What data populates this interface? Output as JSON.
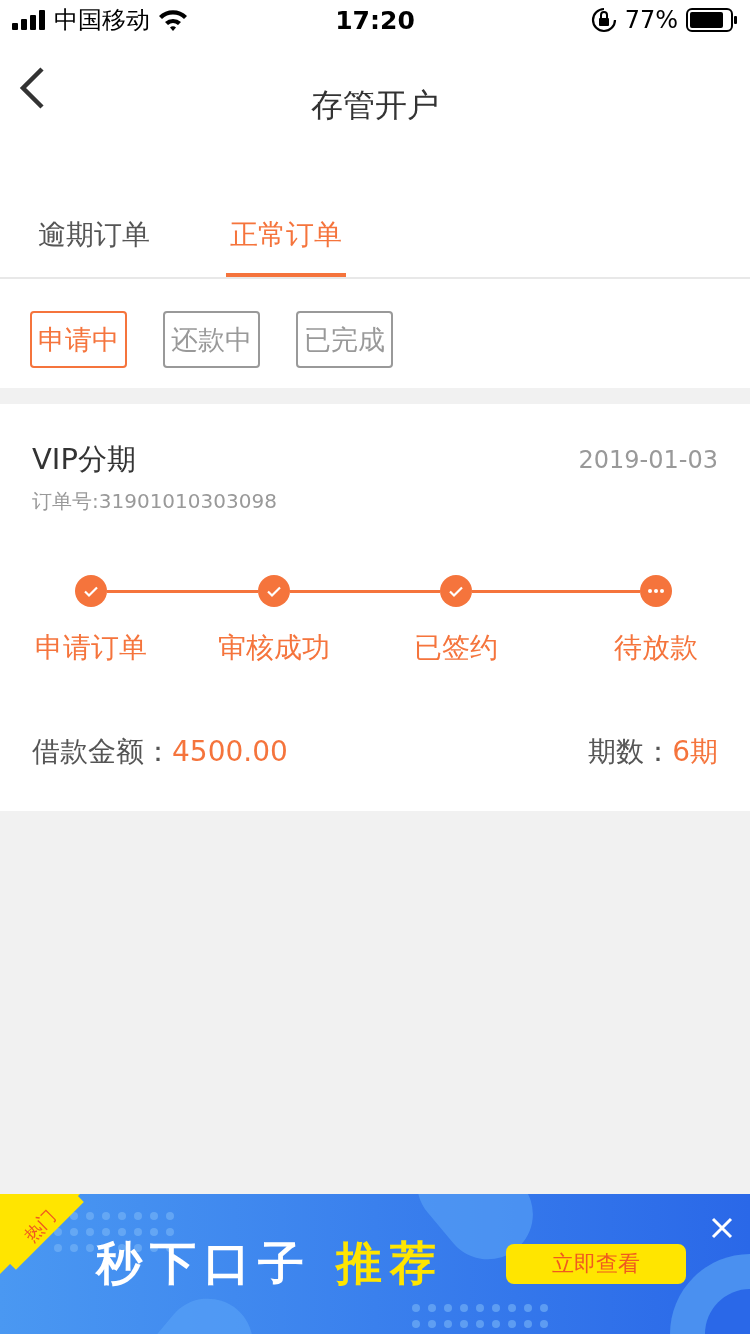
{
  "status_bar": {
    "carrier": "中国移动",
    "time": "17:20",
    "battery": "77%"
  },
  "nav": {
    "title": "存管开户"
  },
  "tabs": [
    {
      "label": "逾期订单",
      "selected": false
    },
    {
      "label": "正常订单",
      "selected": true
    }
  ],
  "filters": [
    {
      "label": "申请中",
      "selected": true
    },
    {
      "label": "还款中",
      "selected": false
    },
    {
      "label": "已完成",
      "selected": false
    }
  ],
  "order": {
    "title": "VIP分期",
    "date": "2019-01-03",
    "order_no": "订单号:31901010303098",
    "steps": [
      {
        "label": "申请订单",
        "kind": "done"
      },
      {
        "label": "审核成功",
        "kind": "done"
      },
      {
        "label": "已签约",
        "kind": "done"
      },
      {
        "label": "待放款",
        "kind": "pending"
      }
    ],
    "amount_label": "借款金额：",
    "amount": "4500.00",
    "periods_label": "期数：",
    "periods": "6期"
  },
  "banner": {
    "tag": "热门",
    "headline": "秒下口子",
    "highlight": "推荐",
    "button": "立即查看"
  }
}
